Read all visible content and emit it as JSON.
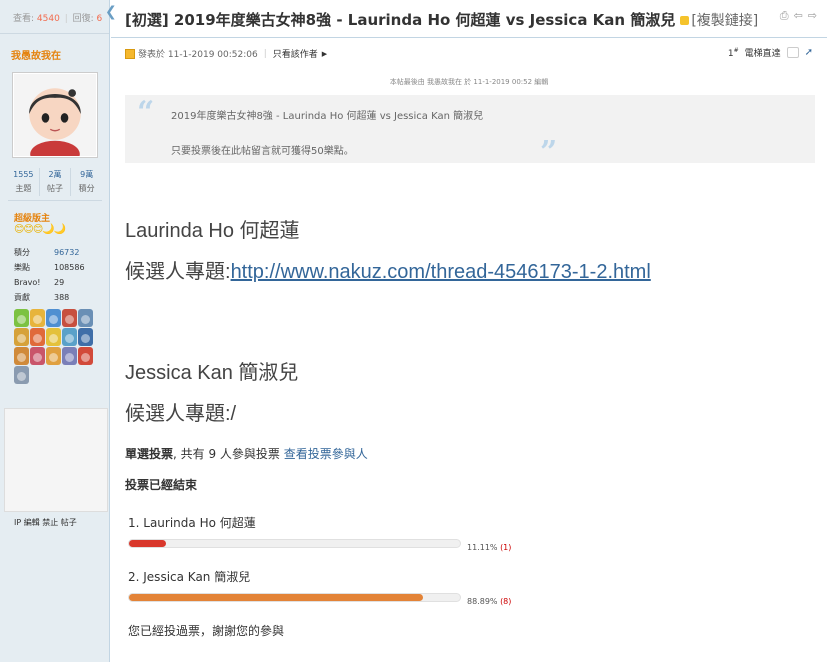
{
  "sidebar": {
    "views_label": "查看:",
    "views": "4540",
    "replies_label": "回復:",
    "replies": "6",
    "username": "我愚故我在",
    "counts": [
      {
        "value": "1555",
        "label": "主題"
      },
      {
        "value": "2萬",
        "label": "帖子"
      },
      {
        "value": "9萬",
        "label": "積分"
      }
    ],
    "rank": "超級版主",
    "stars": "😊😊😊🌙🌙",
    "info": [
      {
        "key": "積分",
        "value": "96732"
      },
      {
        "key": "樂點",
        "value": "108586"
      },
      {
        "key": "Bravo!",
        "value": "29"
      },
      {
        "key": "貢獻",
        "value": "388"
      }
    ],
    "actions": "IP 編輯 禁止 帖子"
  },
  "thread": {
    "title": "[初選] 2019年度樂古女神8強 - Laurinda Ho 何超蓮 vs Jessica Kan 簡淑兒",
    "copy_link": "[複製鏈接]"
  },
  "post": {
    "posted_at": "發表於 11-1-2019 00:52:06",
    "only_author": "只看該作者",
    "floor_no": "1",
    "floor_sup": "#",
    "elevator": "電梯直達",
    "edited_note": "本帖最後由 我愚故我在 於 11-1-2019 00:52 編輯",
    "quote_line1": "2019年度樂古女神8強 - Laurinda Ho 何超蓮 vs Jessica Kan 簡淑兒",
    "quote_line2": "只要投票後在此帖留言就可獲得50樂點。",
    "cand1_name": "Laurinda Ho 何超蓮",
    "cand1_topic_label": "候選人專題:",
    "cand1_topic_link": "http://www.nakuz.com/thread-4546173-1-2.html",
    "cand2_name": "Jessica Kan 簡淑兒",
    "cand2_topic_label": "候選人專題:/"
  },
  "poll": {
    "type": "單選投票",
    "summary": ", 共有 9 人參與投票",
    "view_voters": "查看投票參與人",
    "ended": "投票已經結束",
    "voted_msg": "您已經投過票，謝謝您的參與",
    "options": [
      {
        "label": "1.  Laurinda Ho 何超蓮",
        "fraction": 0.1111,
        "percent": "11.11%",
        "count": "(1)",
        "color": "#d9372b"
      },
      {
        "label": "2.  Jessica Kan 簡淑兒",
        "fraction": 0.8889,
        "percent": "88.89%",
        "count": "(8)",
        "color": "#e38337"
      }
    ]
  }
}
